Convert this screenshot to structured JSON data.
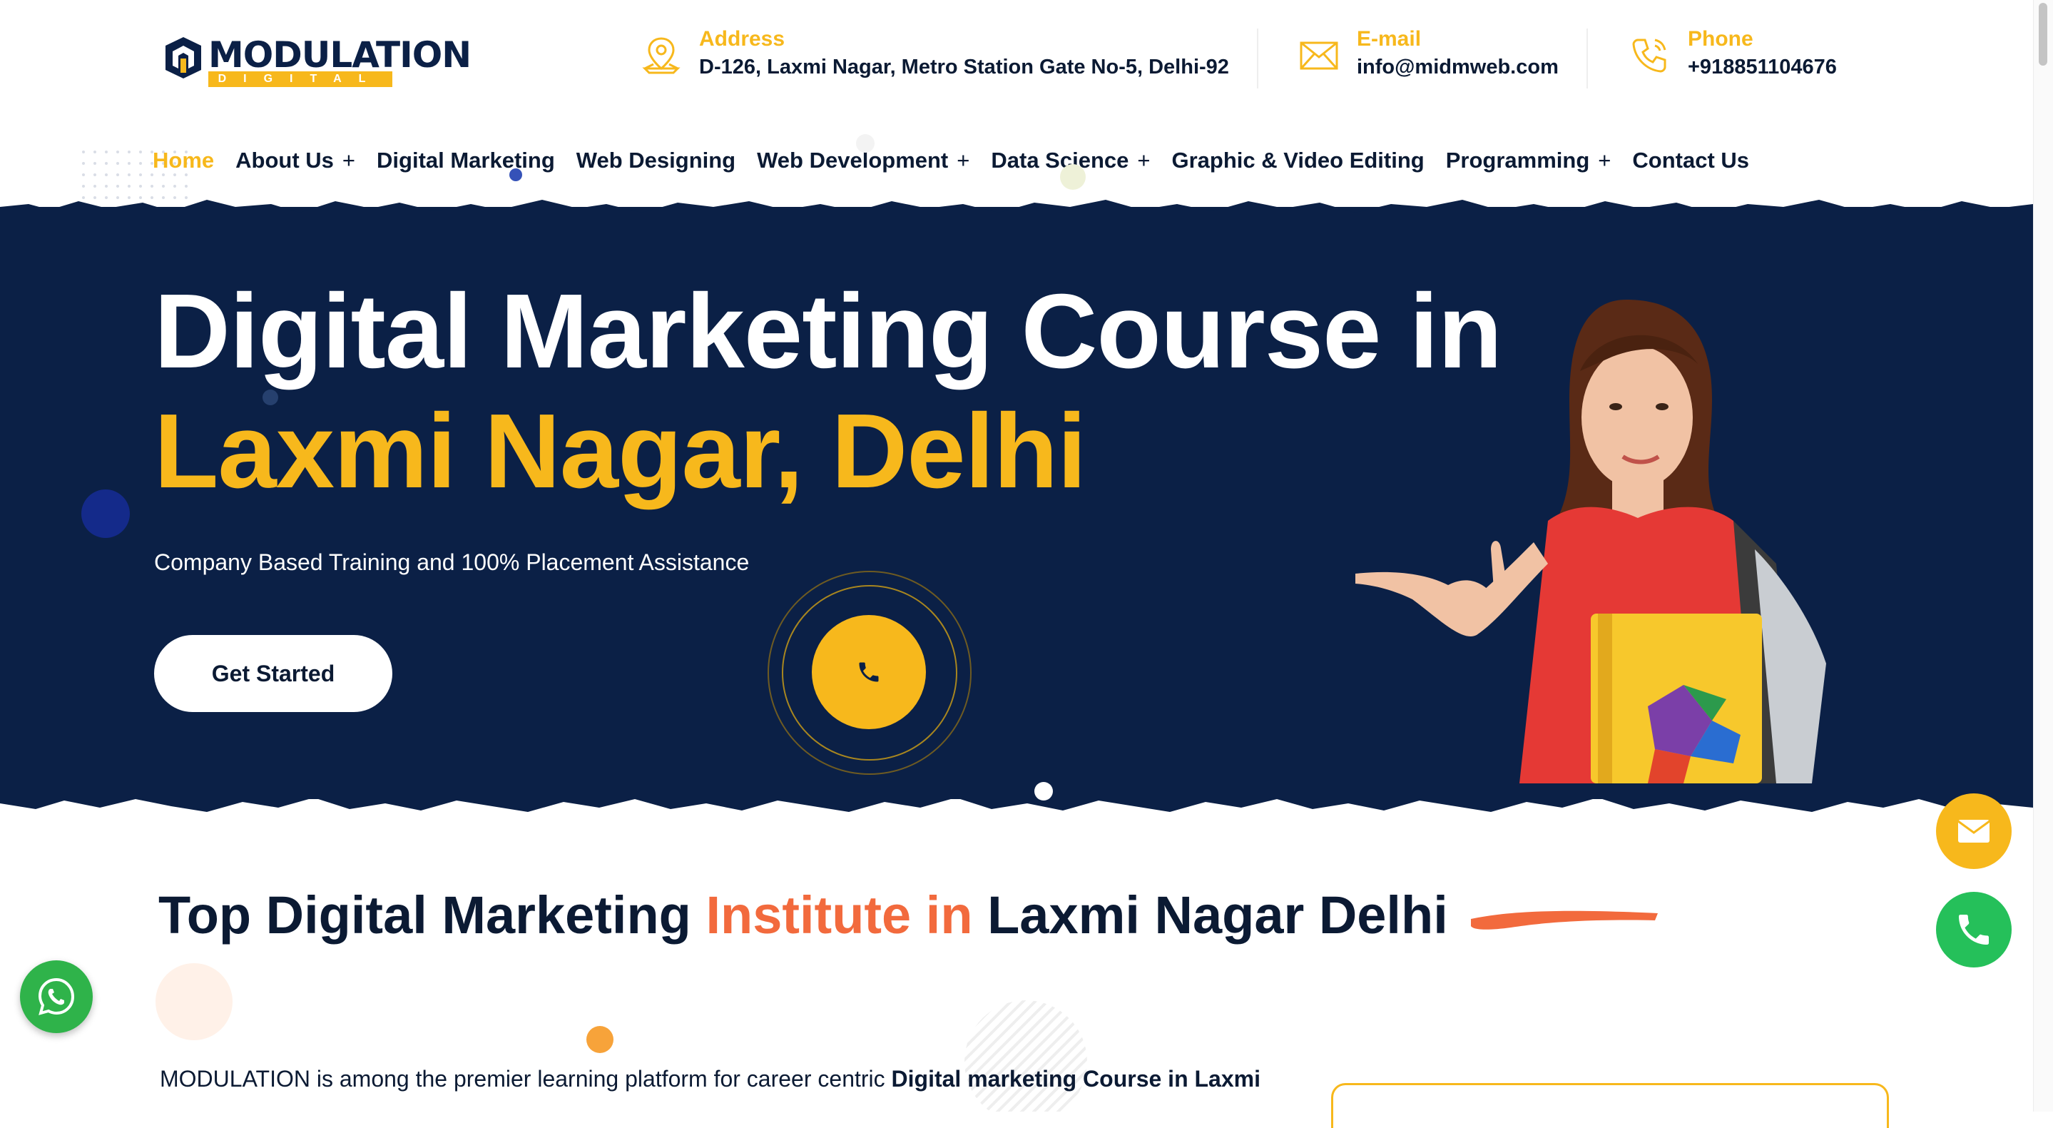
{
  "brand": {
    "name": "MODULATION",
    "tagline": "DIGITAL"
  },
  "contact": {
    "address": {
      "label": "Address",
      "value": "D-126, Laxmi Nagar, Metro Station Gate No-5, Delhi-92",
      "icon": "location-pin-icon"
    },
    "email": {
      "label": "E-mail",
      "value": "info@midmweb.com",
      "icon": "envelope-icon"
    },
    "phone": {
      "label": "Phone",
      "value": "+918851104676",
      "icon": "phone-icon"
    }
  },
  "nav": {
    "items": [
      {
        "label": "Home",
        "active": true,
        "has_submenu": false
      },
      {
        "label": "About Us",
        "has_submenu": true
      },
      {
        "label": "Digital Marketing",
        "has_submenu": false
      },
      {
        "label": "Web Designing",
        "has_submenu": false
      },
      {
        "label": "Web Development",
        "has_submenu": true
      },
      {
        "label": "Data Science",
        "has_submenu": true
      },
      {
        "label": "Graphic & Video Editing",
        "has_submenu": false
      },
      {
        "label": "Programming",
        "has_submenu": true
      },
      {
        "label": "Contact Us",
        "has_submenu": false
      }
    ],
    "submenu_glyph": "+"
  },
  "hero": {
    "title_line1": "Digital Marketing Course in",
    "title_line2": "Laxmi Nagar, Delhi",
    "subtitle": "Company Based Training and 100% Placement Assistance",
    "cta_label": "Get Started",
    "call_icon": "phone-icon"
  },
  "section": {
    "title_part1": "Top Digital Marketing ",
    "title_highlight": "Institute in",
    "title_part2": " Laxmi Nagar Delhi",
    "paragraph_start": "MODULATION is among the premier learning platform for career centric ",
    "paragraph_bold": "Digital marketing Course in Laxmi"
  },
  "floating": {
    "mail_icon": "envelope-icon",
    "phone_icon": "phone-icon",
    "whatsapp_icon": "whatsapp-icon"
  },
  "colors": {
    "navy": "#0b2046",
    "accent": "#f7b81c",
    "highlight": "#f26a3d",
    "whatsapp": "#2fb34a",
    "phone_green": "#25c05a"
  }
}
